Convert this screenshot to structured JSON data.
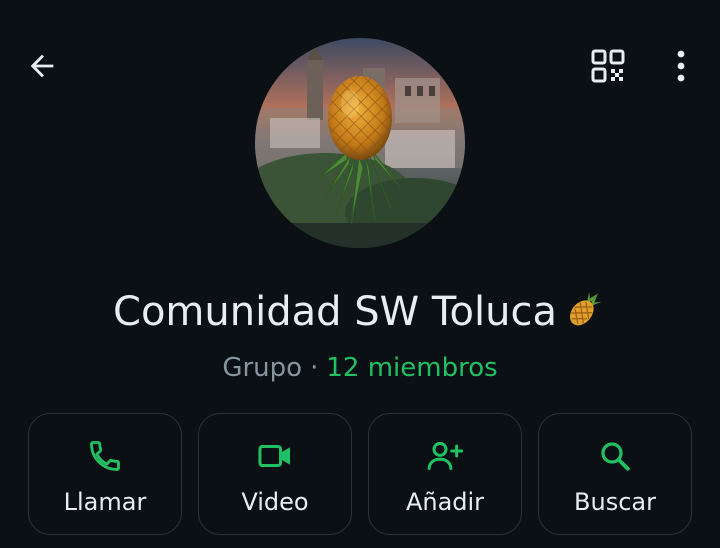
{
  "header": {
    "back_icon": "arrow-left-icon",
    "qr_icon": "qr-code-icon",
    "menu_icon": "more-vertical-icon"
  },
  "profile": {
    "avatar_description_icon": "group-avatar",
    "name": "Comunidad SW Toluca",
    "name_emoji": "pineapple-emoji",
    "type": "Grupo",
    "separator": "·",
    "members": "12 miembros"
  },
  "actions": [
    {
      "label": "Llamar",
      "icon": "phone-icon"
    },
    {
      "label": "Video",
      "icon": "video-camera-icon"
    },
    {
      "label": "Añadir",
      "icon": "add-person-icon"
    },
    {
      "label": "Buscar",
      "icon": "search-icon"
    }
  ],
  "colors": {
    "background": "#0b1014",
    "accent": "#21c063",
    "text_primary": "#e9edef",
    "text_secondary": "#8696a0",
    "card_border": "#2a3338"
  }
}
